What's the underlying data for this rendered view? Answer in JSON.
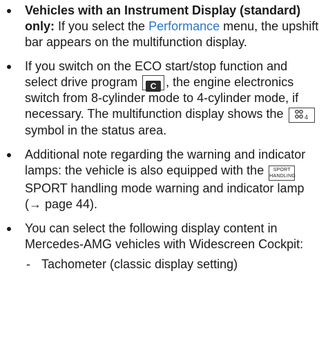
{
  "bullets": [
    {
      "bold_lead": "Vehicles with an Instrument Display (standard) only:",
      "text_a": " If you select the ",
      "link": "Performance",
      "text_b": " menu, the upshift bar appears on the multifunction display."
    },
    {
      "text_a": "If you switch on the ECO start/stop function and select drive program ",
      "key_label": "C",
      "text_b": ", the engine electronics switch from 8-cylinder mode to 4-cylinder mode, if necessary. The multifunction display shows the ",
      "symbol_icon": "cylinder-mode-4-icon",
      "text_c": " symbol in the status area."
    },
    {
      "text_a": "Additional note regarding the warning and indicator lamps: the vehicle is also equipped with the ",
      "lamp_line1": "SPORT",
      "lamp_line2": "HANDLING",
      "text_b": " SPORT handling mode warning and indicator lamp (→ page 44)."
    },
    {
      "text_a": "You can select the following display content in Mercedes-AMG vehicles with Widescreen Cockpit:",
      "sub_items": [
        "Tachometer (classic display setting)"
      ]
    }
  ]
}
